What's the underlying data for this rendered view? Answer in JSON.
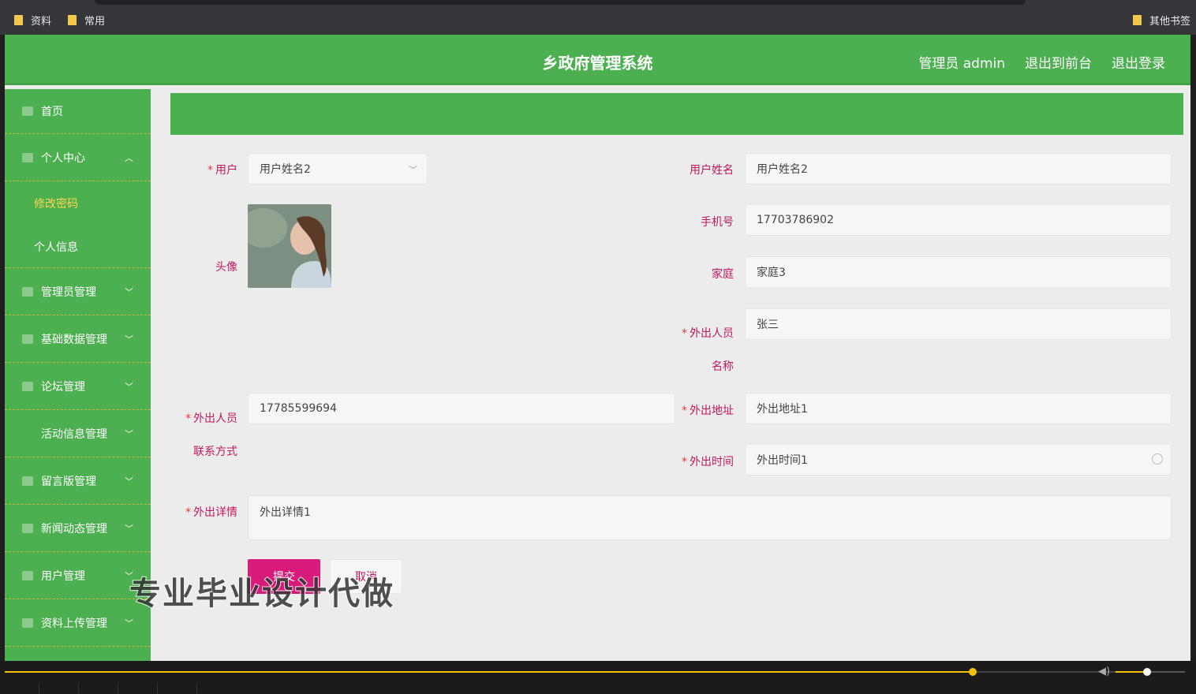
{
  "bookmarks": {
    "item1": "资料",
    "item2": "常用",
    "other": "其他书签"
  },
  "header": {
    "title": "乡政府管理系统",
    "user": "管理员 admin",
    "to_front": "退出到前台",
    "logout": "退出登录"
  },
  "sidebar": {
    "home": "首页",
    "personal": "个人中心",
    "sub_change_password": "修改密码",
    "sub_profile": "个人信息",
    "admin_mgmt": "管理员管理",
    "basic_data": "基础数据管理",
    "forum": "论坛管理",
    "activity": "活动信息管理",
    "guestbook": "留言版管理",
    "news": "新闻动态管理",
    "users": "用户管理",
    "upload": "资料上传管理"
  },
  "form": {
    "user_label": "用户",
    "user_value": "用户姓名2",
    "username_label": "用户姓名",
    "username_value": "用户姓名2",
    "avatar_label": "头像",
    "phone_label": "手机号",
    "phone_value": "17703786902",
    "family_label": "家庭",
    "family_value": "家庭3",
    "outname_label_1": "外出人员",
    "outname_label_2": "名称",
    "outname_value": "张三",
    "contact_label_1": "外出人员",
    "contact_label_2": "联系方式",
    "contact_value": "17785599694",
    "address_label": "外出地址",
    "address_value": "外出地址1",
    "time_label": "外出时间",
    "time_value": "外出时间1",
    "detail_label": "外出详情",
    "detail_value": "外出详情1",
    "submit": "提交",
    "cancel": "取消",
    "required_mark": "*"
  },
  "watermark": "专业毕业设计代做",
  "player": {
    "progress": 0.82,
    "volume": 0.45
  },
  "colors": {
    "primary_green": "#4caf50",
    "label_pink": "#c2185b",
    "submit_magenta": "#d81b7a",
    "menu_active": "#ffd54f"
  }
}
